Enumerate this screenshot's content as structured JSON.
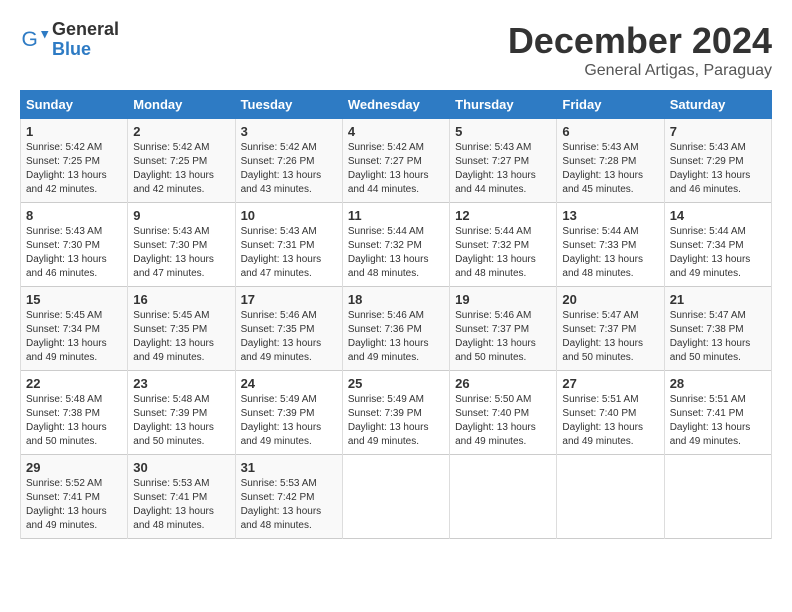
{
  "logo": {
    "general": "General",
    "blue": "Blue"
  },
  "title": "December 2024",
  "location": "General Artigas, Paraguay",
  "headers": [
    "Sunday",
    "Monday",
    "Tuesday",
    "Wednesday",
    "Thursday",
    "Friday",
    "Saturday"
  ],
  "weeks": [
    [
      {
        "day": "1",
        "sunrise": "5:42 AM",
        "sunset": "7:25 PM",
        "daylight": "13 hours and 42 minutes."
      },
      {
        "day": "2",
        "sunrise": "5:42 AM",
        "sunset": "7:25 PM",
        "daylight": "13 hours and 42 minutes."
      },
      {
        "day": "3",
        "sunrise": "5:42 AM",
        "sunset": "7:26 PM",
        "daylight": "13 hours and 43 minutes."
      },
      {
        "day": "4",
        "sunrise": "5:42 AM",
        "sunset": "7:27 PM",
        "daylight": "13 hours and 44 minutes."
      },
      {
        "day": "5",
        "sunrise": "5:43 AM",
        "sunset": "7:27 PM",
        "daylight": "13 hours and 44 minutes."
      },
      {
        "day": "6",
        "sunrise": "5:43 AM",
        "sunset": "7:28 PM",
        "daylight": "13 hours and 45 minutes."
      },
      {
        "day": "7",
        "sunrise": "5:43 AM",
        "sunset": "7:29 PM",
        "daylight": "13 hours and 46 minutes."
      }
    ],
    [
      {
        "day": "8",
        "sunrise": "5:43 AM",
        "sunset": "7:30 PM",
        "daylight": "13 hours and 46 minutes."
      },
      {
        "day": "9",
        "sunrise": "5:43 AM",
        "sunset": "7:30 PM",
        "daylight": "13 hours and 47 minutes."
      },
      {
        "day": "10",
        "sunrise": "5:43 AM",
        "sunset": "7:31 PM",
        "daylight": "13 hours and 47 minutes."
      },
      {
        "day": "11",
        "sunrise": "5:44 AM",
        "sunset": "7:32 PM",
        "daylight": "13 hours and 48 minutes."
      },
      {
        "day": "12",
        "sunrise": "5:44 AM",
        "sunset": "7:32 PM",
        "daylight": "13 hours and 48 minutes."
      },
      {
        "day": "13",
        "sunrise": "5:44 AM",
        "sunset": "7:33 PM",
        "daylight": "13 hours and 48 minutes."
      },
      {
        "day": "14",
        "sunrise": "5:44 AM",
        "sunset": "7:34 PM",
        "daylight": "13 hours and 49 minutes."
      }
    ],
    [
      {
        "day": "15",
        "sunrise": "5:45 AM",
        "sunset": "7:34 PM",
        "daylight": "13 hours and 49 minutes."
      },
      {
        "day": "16",
        "sunrise": "5:45 AM",
        "sunset": "7:35 PM",
        "daylight": "13 hours and 49 minutes."
      },
      {
        "day": "17",
        "sunrise": "5:46 AM",
        "sunset": "7:35 PM",
        "daylight": "13 hours and 49 minutes."
      },
      {
        "day": "18",
        "sunrise": "5:46 AM",
        "sunset": "7:36 PM",
        "daylight": "13 hours and 49 minutes."
      },
      {
        "day": "19",
        "sunrise": "5:46 AM",
        "sunset": "7:37 PM",
        "daylight": "13 hours and 50 minutes."
      },
      {
        "day": "20",
        "sunrise": "5:47 AM",
        "sunset": "7:37 PM",
        "daylight": "13 hours and 50 minutes."
      },
      {
        "day": "21",
        "sunrise": "5:47 AM",
        "sunset": "7:38 PM",
        "daylight": "13 hours and 50 minutes."
      }
    ],
    [
      {
        "day": "22",
        "sunrise": "5:48 AM",
        "sunset": "7:38 PM",
        "daylight": "13 hours and 50 minutes."
      },
      {
        "day": "23",
        "sunrise": "5:48 AM",
        "sunset": "7:39 PM",
        "daylight": "13 hours and 50 minutes."
      },
      {
        "day": "24",
        "sunrise": "5:49 AM",
        "sunset": "7:39 PM",
        "daylight": "13 hours and 49 minutes."
      },
      {
        "day": "25",
        "sunrise": "5:49 AM",
        "sunset": "7:39 PM",
        "daylight": "13 hours and 49 minutes."
      },
      {
        "day": "26",
        "sunrise": "5:50 AM",
        "sunset": "7:40 PM",
        "daylight": "13 hours and 49 minutes."
      },
      {
        "day": "27",
        "sunrise": "5:51 AM",
        "sunset": "7:40 PM",
        "daylight": "13 hours and 49 minutes."
      },
      {
        "day": "28",
        "sunrise": "5:51 AM",
        "sunset": "7:41 PM",
        "daylight": "13 hours and 49 minutes."
      }
    ],
    [
      {
        "day": "29",
        "sunrise": "5:52 AM",
        "sunset": "7:41 PM",
        "daylight": "13 hours and 49 minutes."
      },
      {
        "day": "30",
        "sunrise": "5:53 AM",
        "sunset": "7:41 PM",
        "daylight": "13 hours and 48 minutes."
      },
      {
        "day": "31",
        "sunrise": "5:53 AM",
        "sunset": "7:42 PM",
        "daylight": "13 hours and 48 minutes."
      },
      null,
      null,
      null,
      null
    ]
  ],
  "labels": {
    "sunrise": "Sunrise:",
    "sunset": "Sunset:",
    "daylight": "Daylight:"
  }
}
